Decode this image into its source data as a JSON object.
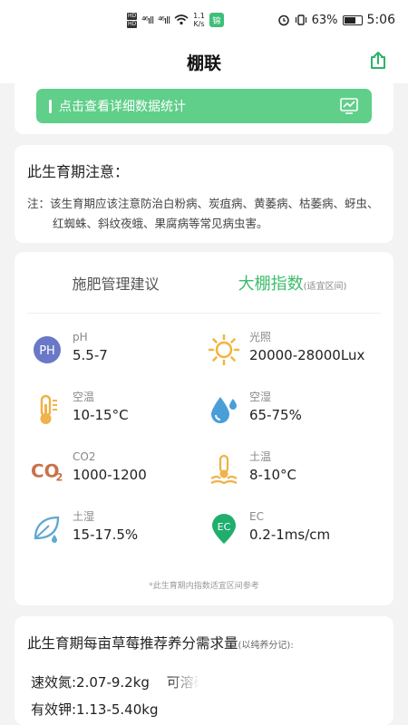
{
  "status_bar": {
    "hd1": "HD",
    "hd2": "HD",
    "sig1": "⁴⁶ıll",
    "sig2": "⁴⁶ıll",
    "speed_val": "1.1",
    "speed_unit": "K/s",
    "app_badge": "锦",
    "battery": "63%",
    "time": "5:06"
  },
  "header": {
    "title": "棚联"
  },
  "stats_button": {
    "label": "点击查看详细数据统计"
  },
  "growth_notice": {
    "title": "此生育期注意：",
    "note": "注：该生育期应该注意防治白粉病、炭疽病、黄萎病、枯萎病、蚜虫、红蜘蛛、斜纹夜蛾、果腐病等常见病虫害。"
  },
  "tabs": {
    "fertilizer": "施肥管理建议",
    "greenhouse": "大棚指数",
    "greenhouse_suffix": "(适宜区间)"
  },
  "indices": [
    {
      "icon": "ph-icon",
      "label": "pH",
      "value": "5.5-7"
    },
    {
      "icon": "sun-icon",
      "label": "光照",
      "value": "20000-28000Lux"
    },
    {
      "icon": "thermometer-icon",
      "label": "空温",
      "value": "10-15°C"
    },
    {
      "icon": "water-drop-icon",
      "label": "空湿",
      "value": "65-75%"
    },
    {
      "icon": "co2-icon",
      "label": "CO2",
      "value": "1000-1200"
    },
    {
      "icon": "soil-temp-icon",
      "label": "土温",
      "value": "8-10°C"
    },
    {
      "icon": "leaf-drop-icon",
      "label": "土湿",
      "value": "15-17.5%"
    },
    {
      "icon": "ec-icon",
      "label": "EC",
      "value": "0.2-1ms/cm"
    }
  ],
  "indices_footnote": "*此生育期内指数适宜区间参考",
  "nutrients": {
    "title": "此生育期每亩草莓推荐养分需求量",
    "title_suffix": "(以纯养分记):",
    "nitrogen": "速效氮:2.07-9.2kg",
    "phosphorus": "可溶磷:C",
    "potassium": "有效钾:1.13-5.40kg"
  },
  "colors": {
    "accent": "#3dbd6b",
    "button": "#5fcf8a"
  }
}
